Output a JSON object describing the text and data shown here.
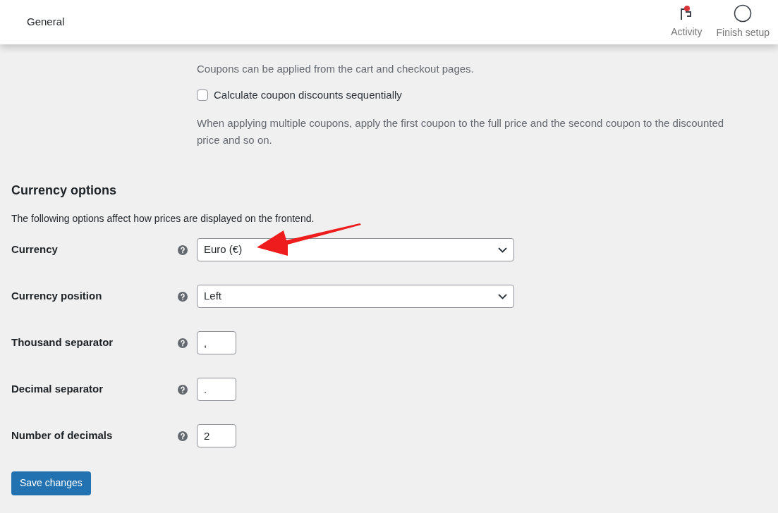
{
  "header": {
    "title": "General",
    "actions": [
      {
        "kind": "activity",
        "label": "Activity",
        "notification": true
      },
      {
        "kind": "setup",
        "label": "Finish setup"
      }
    ]
  },
  "coupons": {
    "description": "Coupons can be applied from the cart and checkout pages.",
    "options": [
      {
        "label": "Calculate coupon discounts sequentially",
        "checked": false,
        "description": "When applying multiple coupons, apply the first coupon to the full price and the second coupon to the discounted price and so on."
      }
    ]
  },
  "currency_options": {
    "title": "Currency options",
    "description": "The following options affect how prices are displayed on the frontend.",
    "fields": [
      {
        "label": "Currency",
        "kind": "select",
        "value": "Euro (€)"
      },
      {
        "label": "Currency position",
        "kind": "select",
        "value": "Left"
      },
      {
        "label": "Thousand separator",
        "kind": "text",
        "value": ","
      },
      {
        "label": "Decimal separator",
        "kind": "text",
        "value": "."
      },
      {
        "label": "Number of decimals",
        "kind": "text",
        "value": "2"
      }
    ]
  },
  "save_button": "Save changes"
}
